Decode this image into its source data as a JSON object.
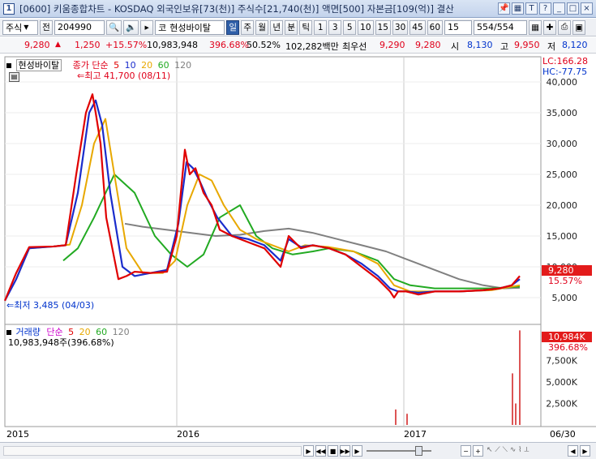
{
  "window": {
    "num": "1",
    "title": "[0600] 키움종합차트 - KOSDAQ 외국인보유[73(천)] 주식수[21,740(천)] 액면[500] 자본금[109(억)] 결산"
  },
  "toolbar": {
    "type_select": "주식",
    "prev_label": "전",
    "code": "204990",
    "market": "코",
    "stock_name": "현성바이탈",
    "periods": [
      "일",
      "주",
      "월",
      "년",
      "분",
      "틱"
    ],
    "intervals": [
      "1",
      "3",
      "5",
      "10",
      "15",
      "30",
      "45",
      "60"
    ],
    "interval_value": "15",
    "count": "554",
    "count_total": "/554"
  },
  "quote": {
    "price": "9,280",
    "change": "1,250",
    "change_pct": "+15.57%",
    "volume": "10,983,948",
    "vol_ratio": "396.68%",
    "turnover": "50.52%",
    "amount": "102,282백만",
    "best_ask_label": "최우선",
    "best_ask": "9,290",
    "best_bid": "9,280",
    "open_label": "시",
    "open": "8,130",
    "high_label": "고",
    "high": "9,950",
    "low_label": "저",
    "low": "8,120"
  },
  "price_panel": {
    "stock_label": "현성바이탈",
    "ma_label": "종가 단순",
    "ma_periods": [
      "5",
      "10",
      "20",
      "60",
      "120"
    ],
    "high_note": "최고 41,700 (08/11)",
    "low_note": "최저 3,485 (04/03)",
    "lc": "LC:166.28",
    "hc": "HC:-77.75",
    "current_price": "9,280",
    "current_pct": "15.57%",
    "y_ticks": [
      "40,000",
      "35,000",
      "30,000",
      "25,000",
      "20,000",
      "15,000",
      "10,000",
      "5,000"
    ]
  },
  "volume_panel": {
    "label": "거래량",
    "ma_label": "단순",
    "ma_periods": [
      "5",
      "20",
      "60",
      "120"
    ],
    "value_note": "10,983,948주(396.68%)",
    "current": "10,984K",
    "current_pct": "396.68%",
    "y_ticks": [
      "7,500K",
      "5,000K",
      "2,500K"
    ]
  },
  "x_axis": {
    "labels": [
      "2015",
      "2016",
      "2017"
    ],
    "right_date": "06/30"
  },
  "colors": {
    "ma5": "#e00000",
    "ma10": "#1a2ccc",
    "ma20": "#e8a800",
    "ma60": "#22aa22",
    "ma120": "#808080"
  },
  "chart_data": {
    "type": "line",
    "title": "",
    "series": [
      {
        "name": "5",
        "x": [
          0,
          14,
          30,
          60,
          75,
          88,
          100,
          108,
          112,
          118,
          125,
          140,
          150,
          160,
          180,
          200,
          212,
          222,
          228,
          235,
          245,
          255,
          265,
          280,
          300,
          320,
          340,
          350,
          365,
          380,
          400,
          420,
          440,
          460,
          475,
          480,
          485,
          495,
          510,
          530,
          560,
          590,
          610,
          625,
          635
        ],
        "y": [
          4.5,
          9,
          13.2,
          13.3,
          13.5,
          25,
          35,
          38,
          35,
          30,
          18,
          8,
          8.5,
          9.2,
          9,
          9.2,
          15,
          29,
          25,
          26,
          22,
          20,
          16,
          15,
          14,
          13,
          10,
          15,
          13,
          13.5,
          13,
          12,
          10,
          8,
          6,
          5,
          6,
          6,
          5.5,
          6,
          6,
          6.2,
          6.5,
          7,
          8.5
        ]
      },
      {
        "name": "10",
        "x": [
          0,
          14,
          30,
          60,
          75,
          90,
          104,
          112,
          120,
          130,
          145,
          160,
          180,
          200,
          214,
          224,
          232,
          240,
          250,
          262,
          280,
          300,
          320,
          340,
          350,
          365,
          380,
          400,
          420,
          440,
          460,
          475,
          485,
          495,
          510,
          530,
          560,
          590,
          610,
          625,
          635
        ],
        "y": [
          4.5,
          8,
          13,
          13.3,
          13.5,
          22,
          35,
          37,
          33,
          22,
          10,
          8.5,
          9,
          9.5,
          17,
          27,
          26,
          24,
          21,
          18,
          15,
          14.5,
          13.5,
          11,
          14.5,
          13.2,
          13.5,
          13,
          12,
          10.5,
          8.5,
          6.5,
          6,
          6,
          5.8,
          6,
          6,
          6.2,
          6.5,
          7,
          8
        ]
      },
      {
        "name": "20",
        "x": [
          14,
          30,
          60,
          80,
          95,
          110,
          124,
          135,
          150,
          170,
          195,
          210,
          225,
          240,
          255,
          270,
          290,
          310,
          330,
          350,
          370,
          400,
          430,
          460,
          480,
          500,
          520,
          560,
          600,
          635
        ],
        "y": [
          8,
          13,
          13.3,
          13.6,
          20,
          30,
          34,
          25,
          13,
          9,
          9,
          11,
          20,
          25,
          24,
          20,
          16,
          14.5,
          13.5,
          12.5,
          13.5,
          13.2,
          12.5,
          10.5,
          7,
          6,
          6,
          6,
          6.2,
          7
        ]
      },
      {
        "name": "60",
        "x": [
          72,
          90,
          110,
          135,
          160,
          185,
          205,
          225,
          245,
          265,
          290,
          310,
          330,
          355,
          380,
          400,
          430,
          460,
          480,
          500,
          530,
          560,
          600,
          635
        ],
        "y": [
          11,
          13,
          18,
          25,
          22,
          15,
          12,
          10,
          12,
          18,
          20,
          15,
          13,
          12,
          12.5,
          13,
          12.5,
          11,
          8,
          7,
          6.5,
          6.5,
          6.5,
          6.8
        ]
      },
      {
        "name": "120",
        "x": [
          148,
          170,
          200,
          230,
          260,
          290,
          320,
          350,
          380,
          410,
          440,
          470,
          500,
          530,
          560,
          590,
          615,
          635
        ],
        "y": [
          17,
          16.5,
          16,
          15.5,
          15,
          15.2,
          15.8,
          16.2,
          15.5,
          14.5,
          13.5,
          12.5,
          11,
          9.5,
          8,
          7,
          6.5,
          6.6
        ]
      }
    ],
    "volume_spikes": [
      {
        "x": 482,
        "value": 1.8
      },
      {
        "x": 496,
        "value": 1.3
      },
      {
        "x": 626,
        "value": 6.0
      },
      {
        "x": 630,
        "value": 2.5
      },
      {
        "x": 635,
        "value": 11.0
      }
    ],
    "ylim": [
      0,
      42
    ],
    "volume_ylim": [
      0,
      11
    ]
  }
}
